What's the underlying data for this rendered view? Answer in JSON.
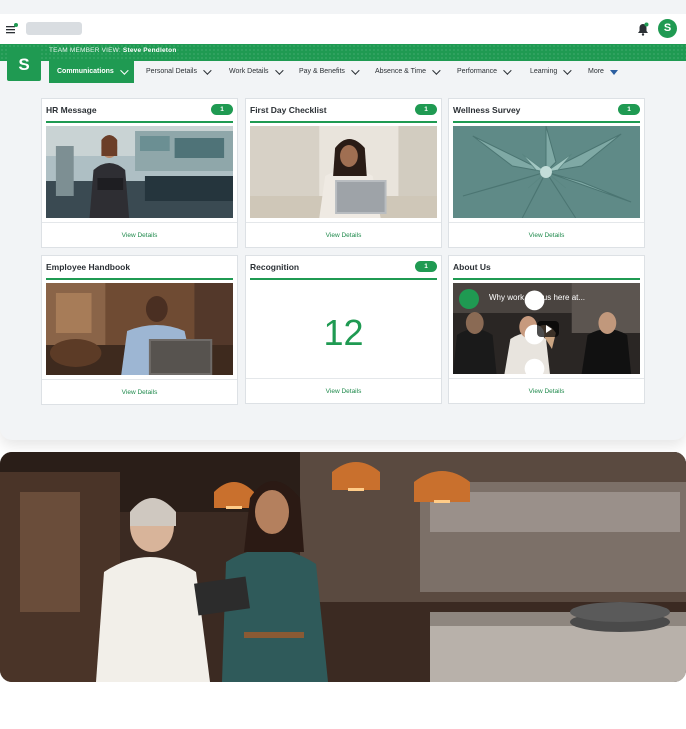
{
  "header": {
    "team_member_label": "TEAM MEMBER VIEW:",
    "team_member_name": "Steve Pendleton",
    "logo_letter": "S",
    "avatar_letter": "S"
  },
  "nav": {
    "items": [
      {
        "label": "Communications",
        "active": true
      },
      {
        "label": "Personal Details"
      },
      {
        "label": "Work Details"
      },
      {
        "label": "Pay & Benefits"
      },
      {
        "label": "Absence & Time"
      },
      {
        "label": "Performance"
      },
      {
        "label": "Learning"
      },
      {
        "label": "More"
      }
    ]
  },
  "cards": [
    {
      "title": "HR Message",
      "badge": "1",
      "link": "View Details",
      "image": "person-with-laptop-office"
    },
    {
      "title": "First Day Checklist",
      "badge": "1",
      "link": "View Details",
      "image": "woman-at-laptop"
    },
    {
      "title": "Wellness Survey",
      "badge": "1",
      "link": "View Details",
      "image": "succulent-plant"
    },
    {
      "title": "Employee Handbook",
      "link": "View Details",
      "image": "man-at-laptop-workshop"
    },
    {
      "title": "Recognition",
      "badge": "1",
      "value": "12",
      "link": "View Details"
    },
    {
      "title": "About Us",
      "link": "View Details",
      "video_title": "Why work with us here at..."
    }
  ],
  "colors": {
    "brand_green": "#1f9a52",
    "text_dark": "#2b3035",
    "link_green": "#1f8a4c"
  },
  "hero": {
    "image": "two-women-in-restaurant-kitchen-with-tablet"
  }
}
